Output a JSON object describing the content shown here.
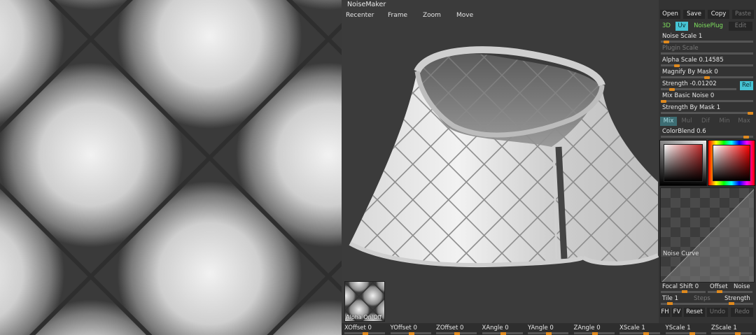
{
  "viewport": {
    "title": "NoiseMaker",
    "toolbar": [
      "Recenter",
      "Frame",
      "Zoom",
      "Move"
    ],
    "alpha_toggle_label": "Alpha On/Off"
  },
  "panel": {
    "file_buttons": [
      "Open",
      "Save",
      "Copy",
      "Paste"
    ],
    "mode_buttons": {
      "three_d": "3D",
      "uv": "Uv",
      "noiseplug": "NoisePlug",
      "edit": "Edit"
    },
    "sliders": [
      {
        "label": "Noise Scale",
        "value": "1",
        "level": 0.03,
        "enabled": true
      },
      {
        "label": "Plugin Scale",
        "value": "",
        "level": 0.0,
        "enabled": false
      },
      {
        "label": "Alpha Scale",
        "value": "0.14585",
        "level": 0.15,
        "enabled": true
      },
      {
        "label": "Magnify By Mask",
        "value": "0",
        "level": 0.5,
        "enabled": true
      },
      {
        "label": "Strength",
        "value": "-0.01202",
        "level": 0.12,
        "enabled": true
      },
      {
        "label": "Mix Basic Noise",
        "value": "0",
        "level": 0.0,
        "enabled": true
      },
      {
        "label": "Strength By Mask",
        "value": "1",
        "level": 1.0,
        "enabled": true
      }
    ],
    "rel_label": "Rel",
    "blend_modes": [
      "Mix",
      "Mul",
      "Dif",
      "Min",
      "Max"
    ],
    "color_blend": {
      "label": "ColorBlend",
      "value": "0.6",
      "level": 0.95
    },
    "noise_curve_label": "Noise Curve",
    "focal_shift": {
      "label": "Focal Shift",
      "value": "0"
    },
    "offset_label": "Offset",
    "noise_label": "Noise",
    "tile": {
      "label": "Tile",
      "value": "1"
    },
    "steps_label": "Steps",
    "strength_label": "Strength",
    "curve_buttons": [
      "FH",
      "FV",
      "Reset",
      "Undo",
      "Redo"
    ]
  },
  "bottombar": [
    {
      "label": "XOffset",
      "value": "0"
    },
    {
      "label": "YOffset",
      "value": "0"
    },
    {
      "label": "ZOffset",
      "value": "0"
    },
    {
      "label": "XAngle",
      "value": "0"
    },
    {
      "label": "YAngle",
      "value": "0"
    },
    {
      "label": "ZAngle",
      "value": "0"
    },
    {
      "label": "XScale",
      "value": "1"
    },
    {
      "label": "YScale",
      "value": "1"
    },
    {
      "label": "ZScale",
      "value": "1"
    }
  ],
  "colors": {
    "accent": "#46c3d4",
    "slider_knob": "#e08a1e",
    "active_green": "#7ee05e"
  }
}
